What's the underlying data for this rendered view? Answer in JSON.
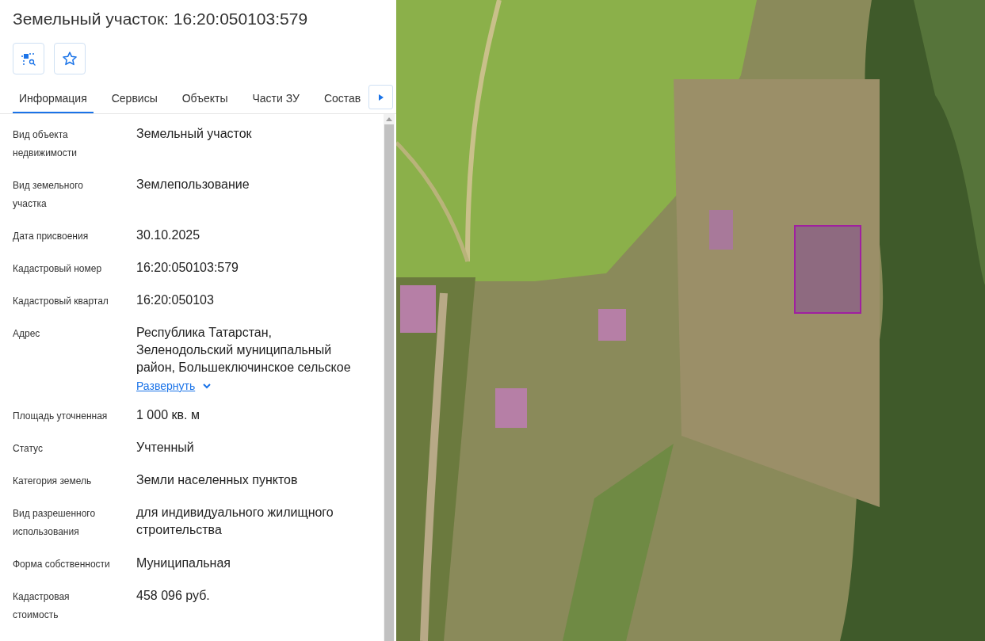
{
  "title": "Земельный участок: 16:20:050103:579",
  "tabs": [
    {
      "label": "Информация",
      "selected": true
    },
    {
      "label": "Сервисы",
      "selected": false
    },
    {
      "label": "Объекты",
      "selected": false
    },
    {
      "label": "Части ЗУ",
      "selected": false
    },
    {
      "label": "Состав",
      "selected": false
    }
  ],
  "fields": [
    {
      "label": "Вид объекта недвижимости",
      "value": "Земельный участок"
    },
    {
      "label": "Вид земельного участка",
      "value": "Землепользование"
    },
    {
      "label": "Дата присвоения",
      "value": "30.10.2025"
    },
    {
      "label": "Кадастровый номер",
      "value": "16:20:050103:579"
    },
    {
      "label": "Кадастровый квартал",
      "value": "16:20:050103"
    },
    {
      "label": "Адрес",
      "value": "Республика Татарстан, Зеленодольский муниципальный район, Большеключинское сельское",
      "expand_link": "Развернуть",
      "expanded": false
    },
    {
      "label": "Площадь уточненная",
      "value": "1 000 кв. м"
    },
    {
      "label": "Статус",
      "value": "Учтенный"
    },
    {
      "label": "Категория земель",
      "value": "Земли населенных пунктов"
    },
    {
      "label": "Вид разрешенного использования",
      "value": "для индивидуального жилищного строительства"
    },
    {
      "label": "Форма собственности",
      "value": "Муниципальная"
    },
    {
      "label": "Кадастровая стоимость",
      "value": "458 096 руб."
    }
  ]
}
